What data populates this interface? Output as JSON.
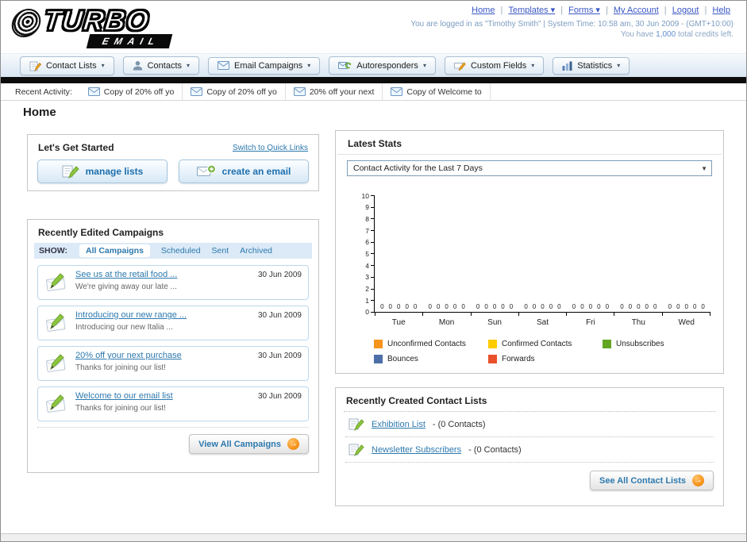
{
  "header": {
    "logo_top": "TURBO",
    "logo_bottom": "EMAIL",
    "top_links": [
      {
        "label": "Home",
        "dropdown": false
      },
      {
        "label": "Templates",
        "dropdown": true
      },
      {
        "label": "Forms",
        "dropdown": true
      },
      {
        "label": "My Account",
        "dropdown": false
      },
      {
        "label": "Logout",
        "dropdown": false
      },
      {
        "label": "Help",
        "dropdown": false
      }
    ],
    "session_info": "You are logged in as \"Timothy Smith\" | System Time: 10:58 am, 30 Jun 2009 - (GMT+10:00)",
    "credits_prefix": "You have ",
    "credits_value": "1,000",
    "credits_suffix": " total credits left."
  },
  "nav": {
    "tabs": [
      {
        "label": "Contact Lists",
        "icon": "contact-lists-icon"
      },
      {
        "label": "Contacts",
        "icon": "contacts-icon"
      },
      {
        "label": "Email Campaigns",
        "icon": "email-campaigns-icon"
      },
      {
        "label": "Autoresponders",
        "icon": "autoresponders-icon"
      },
      {
        "label": "Custom Fields",
        "icon": "custom-fields-icon"
      },
      {
        "label": "Statistics",
        "icon": "statistics-icon"
      }
    ]
  },
  "activity": {
    "label": "Recent Activity:",
    "items": [
      {
        "label": "Copy of 20% off yo"
      },
      {
        "label": "Copy of 20% off yo"
      },
      {
        "label": "20% off your next"
      },
      {
        "label": "Copy of Welcome to"
      }
    ]
  },
  "main": {
    "title": "Home"
  },
  "get_started": {
    "title": "Let's Get Started",
    "switch_link": "Switch to Quick Links",
    "buttons": [
      {
        "label": "manage lists"
      },
      {
        "label": "create an email"
      }
    ]
  },
  "campaigns": {
    "title": "Recently Edited Campaigns",
    "show_label": "SHOW:",
    "filters": [
      "All Campaigns",
      "Scheduled",
      "Sent",
      "Archived"
    ],
    "selected_filter": "All Campaigns",
    "items": [
      {
        "title": "See us at the retail food ...",
        "subtitle": "We're giving away our late ...",
        "date": "30 Jun 2009"
      },
      {
        "title": "Introducing our new range ...",
        "subtitle": "Introducing our new Italia ...",
        "date": "30 Jun 2009"
      },
      {
        "title": "20% off your next purchase",
        "subtitle": "Thanks for joining our list!",
        "date": "30 Jun 2009"
      },
      {
        "title": "Welcome to our email list",
        "subtitle": "Thanks for joining our list!",
        "date": "30 Jun 2009"
      }
    ],
    "view_all_label": "View All Campaigns"
  },
  "stats": {
    "title": "Latest Stats",
    "selected_range": "Contact Activity for the Last 7 Days",
    "chart_data": {
      "type": "bar",
      "title": "Contact Activity for the Last 7 Days",
      "categories": [
        "Tue",
        "Mon",
        "Sun",
        "Sat",
        "Fri",
        "Thu",
        "Wed"
      ],
      "series": [
        {
          "name": "Unconfirmed Contacts",
          "color": "#f7941d",
          "values": [
            0,
            0,
            0,
            0,
            0,
            0,
            0
          ]
        },
        {
          "name": "Confirmed Contacts",
          "color": "#ffcc00",
          "values": [
            0,
            0,
            0,
            0,
            0,
            0,
            0
          ]
        },
        {
          "name": "Unsubscribes",
          "color": "#61a521",
          "values": [
            0,
            0,
            0,
            0,
            0,
            0,
            0
          ]
        },
        {
          "name": "Bounces",
          "color": "#4d6fa8",
          "values": [
            0,
            0,
            0,
            0,
            0,
            0,
            0
          ]
        },
        {
          "name": "Forwards",
          "color": "#e8502a",
          "values": [
            0,
            0,
            0,
            0,
            0,
            0,
            0
          ]
        }
      ],
      "ylim": [
        0,
        10
      ],
      "yticks": [
        0,
        1,
        2,
        3,
        4,
        5,
        6,
        7,
        8,
        9,
        10
      ],
      "grid": false,
      "legend_position": "bottom"
    }
  },
  "contact_lists": {
    "title": "Recently Created Contact Lists",
    "items": [
      {
        "name": "Exhibition List",
        "suffix": "- (0 Contacts)"
      },
      {
        "name": "Newsletter Subscribers",
        "suffix": "- (0 Contacts)"
      }
    ],
    "see_all_label": "See All Contact Lists"
  }
}
